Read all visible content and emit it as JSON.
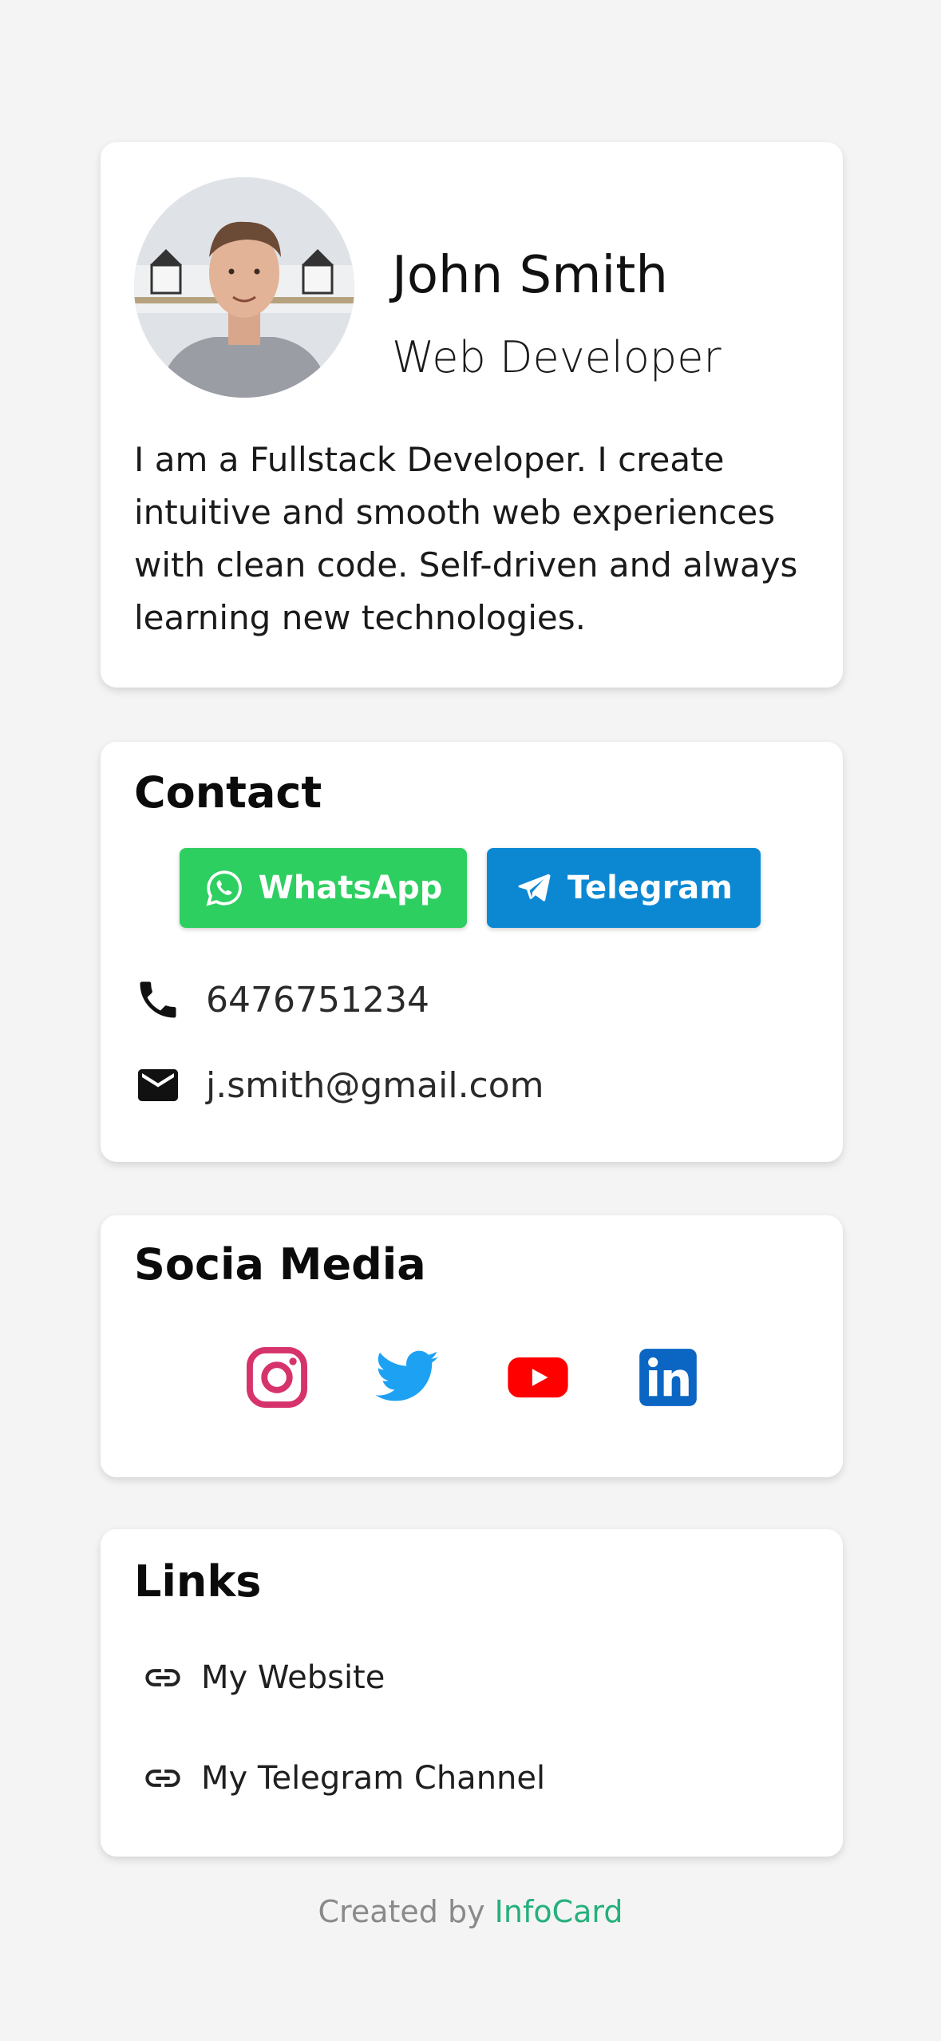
{
  "profile": {
    "name": "John Smith",
    "role": "Web Developer",
    "bio": "I am a Fullstack Developer. I create intuitive and smooth web experiences with clean code. Self-driven and always learning new technologies."
  },
  "contact": {
    "title": "Contact",
    "whatsapp_label": "WhatsApp",
    "telegram_label": "Telegram",
    "phone": "6476751234",
    "email": "j.smith@gmail.com",
    "colors": {
      "whatsapp": "#2ecf61",
      "telegram": "#0c88d3"
    }
  },
  "social": {
    "title": "Socia Media",
    "icons": [
      "instagram-icon",
      "twitter-icon",
      "youtube-icon",
      "linkedin-icon"
    ]
  },
  "links": {
    "title": "Links",
    "items": [
      {
        "label": "My Website"
      },
      {
        "label": "My Telegram Channel"
      }
    ]
  },
  "footer": {
    "prefix": "Created by",
    "brand": "InfoCard",
    "brand_color": "#25b07c"
  }
}
